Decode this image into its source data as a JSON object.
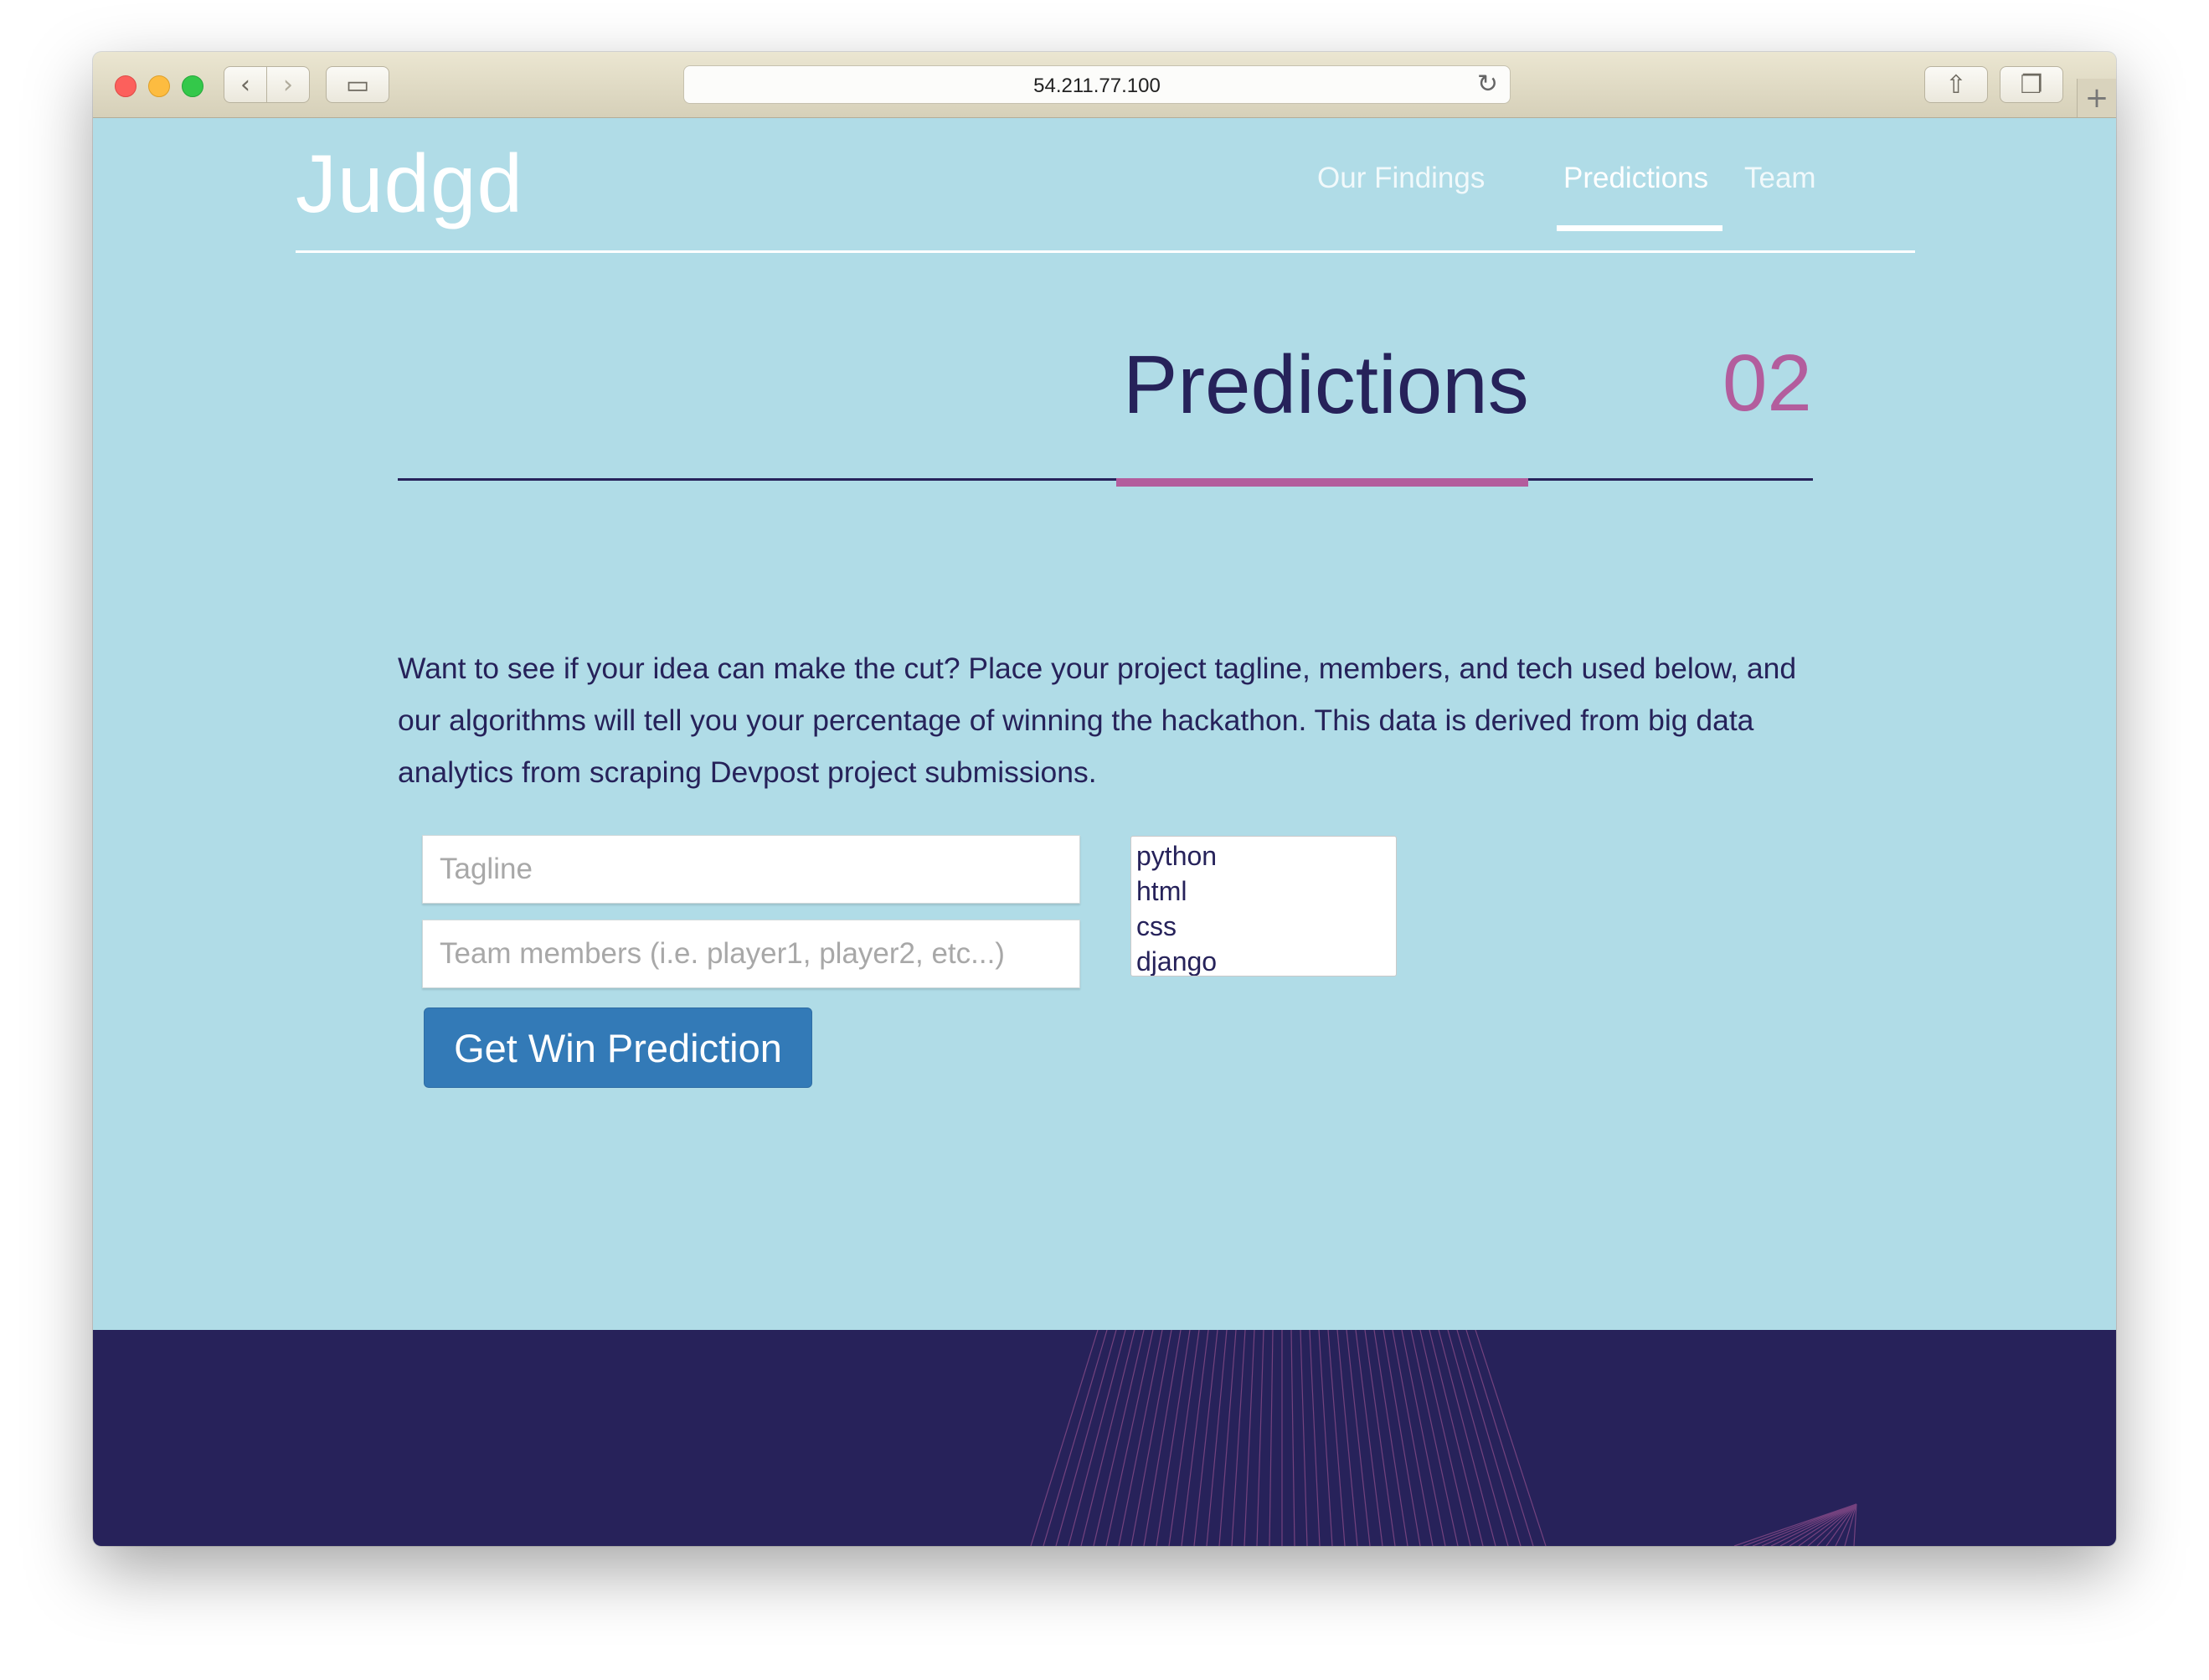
{
  "browser": {
    "url": "54.211.77.100",
    "back_glyph": "‹",
    "forward_glyph": "›",
    "sidebar_glyph": "▭",
    "share_glyph": "⇧",
    "tabs_glyph": "❐",
    "reload_glyph": "↻",
    "newtab_glyph": "+"
  },
  "site": {
    "logo": "Judgd",
    "nav": {
      "findings": "Our Findings",
      "predictions": "Predictions",
      "team": "Team"
    }
  },
  "section": {
    "title": "Predictions",
    "number": "02",
    "intro": "Want to see if your idea can make the cut? Place your project tagline, members, and tech used below, and our algorithms will tell you your percentage of winning the hackathon. This data is derived from big data analytics from scraping Devpost project submissions."
  },
  "form": {
    "tagline_placeholder": "Tagline",
    "team_placeholder": "Team members (i.e. player1, player2, etc...)",
    "tech_options": [
      "python",
      "html",
      "css",
      "django"
    ],
    "submit_label": "Get Win Prediction"
  },
  "colors": {
    "page_background": "#b0dce7",
    "navy": "#26225a",
    "accent_pink": "#b35d9d",
    "button_blue": "#337ab7",
    "footer_background": "#27225a"
  }
}
